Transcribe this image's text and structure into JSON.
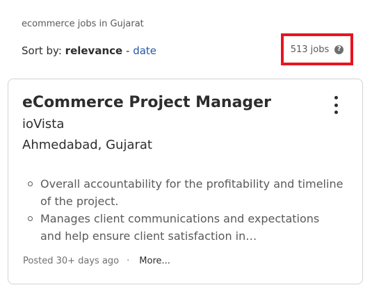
{
  "search": {
    "context": "ecommerce jobs in Gujarat"
  },
  "sort": {
    "prefix": "Sort by:",
    "active": "relevance",
    "separator": "-",
    "alternate": "date"
  },
  "results": {
    "count_label": "513 jobs",
    "help_icon": "question-circle-icon",
    "highlight_color": "#e8141f"
  },
  "job": {
    "title": "eCommerce Project Manager",
    "company": "ioVista",
    "location": "Ahmedabad, Gujarat",
    "menu_icon": "vertical-ellipsis-icon",
    "snippet": [
      "Overall accountability for the profitability and timeline of the project.",
      "Manages client communications and expectations and help ensure client satisfaction in…"
    ],
    "posted": "Posted 30+ days ago",
    "separator": "·",
    "more_label": "More..."
  },
  "colors": {
    "link": "#2557a7",
    "text": "#2d2d2d",
    "muted": "#595959",
    "border": "#d4d2d0"
  }
}
